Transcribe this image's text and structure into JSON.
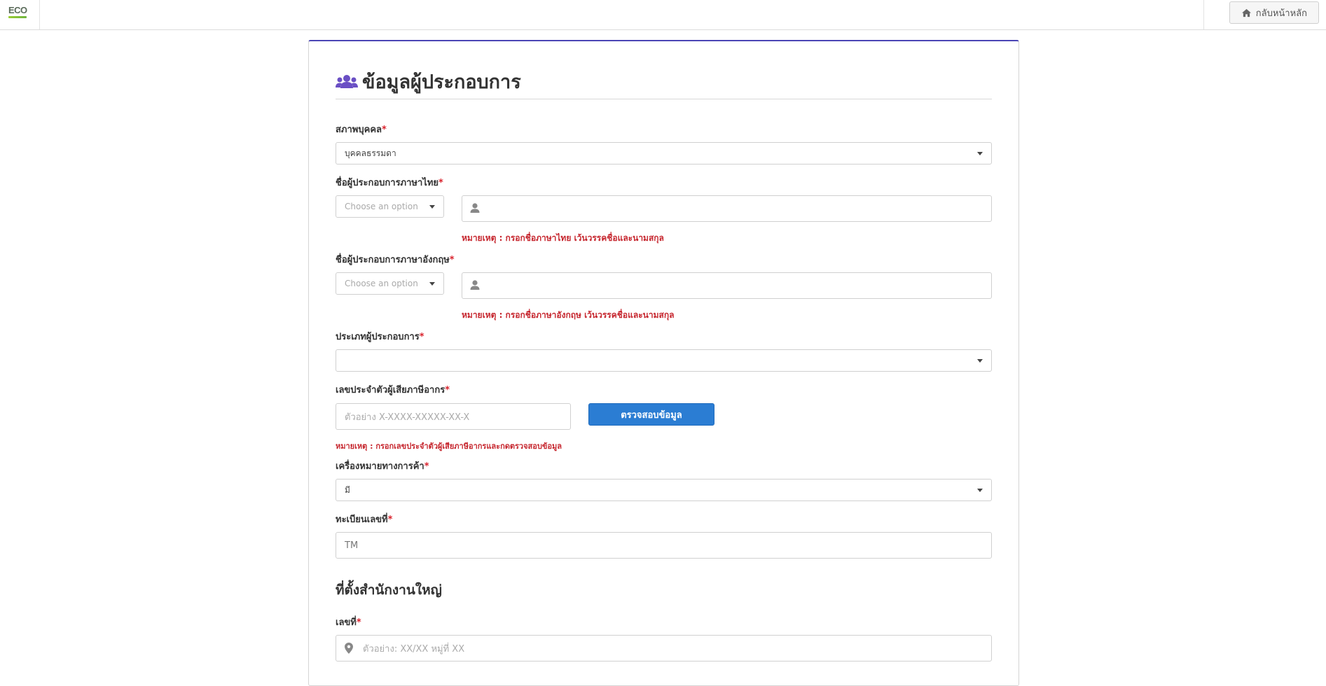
{
  "header": {
    "logo_text": "ECO",
    "home_button": "กลับหน้าหลัก"
  },
  "form": {
    "title": "ข้อมูลผู้ประกอบการ",
    "person_status": {
      "label": "สภาพบุคคล",
      "value": "บุคคลธรรมดา"
    },
    "name_th": {
      "label": "ชื่อผู้ประกอบการภาษาไทย",
      "prefix_placeholder": "Choose an option",
      "note": "หมายเหตุ : กรอกชื่อภาษาไทย เว้นวรรคชื่อและนามสกุล"
    },
    "name_en": {
      "label": "ชื่อผู้ประกอบการภาษาอังกฤษ",
      "prefix_placeholder": "Choose an option",
      "note": "หมายเหตุ : กรอกชื่อภาษาอังกฤษ เว้นวรรคชื่อและนามสกุล"
    },
    "operator_type": {
      "label": "ประเภทผู้ประกอบการ",
      "value": ""
    },
    "tax_id": {
      "label": "เลขประจำตัวผู้เสียภาษีอากร",
      "placeholder": "ตัวอย่าง   X-XXXX-XXXXX-XX-X",
      "check_button": "ตรวจสอบข้อมูล",
      "note": "หมายเหตุ : กรอกเลขประจำตัวผู้เสียภาษีอากรและกดตรวจสอบข้อมูล"
    },
    "trademark": {
      "label": "เครื่องหมายทางการค้า",
      "value": "มี"
    },
    "registration_no": {
      "label": "ทะเบียนเลขที่",
      "placeholder": "TM"
    },
    "hq_section_title": "ที่ตั้งสำนักงานใหญ่",
    "address_no": {
      "label": "เลขที่",
      "placeholder": "ตัวอย่าง: XX/XX หมู่ที่ XX"
    },
    "required_mark": "*"
  },
  "colors": {
    "accent": "#4a45b5",
    "required": "#d9232d",
    "primary_button": "#2b7dd3",
    "icon_purple": "#6a4fc4"
  },
  "icons": {
    "title": "users-icon",
    "home": "home-icon",
    "user_field": "user-icon",
    "address_field": "map-marker-icon"
  }
}
